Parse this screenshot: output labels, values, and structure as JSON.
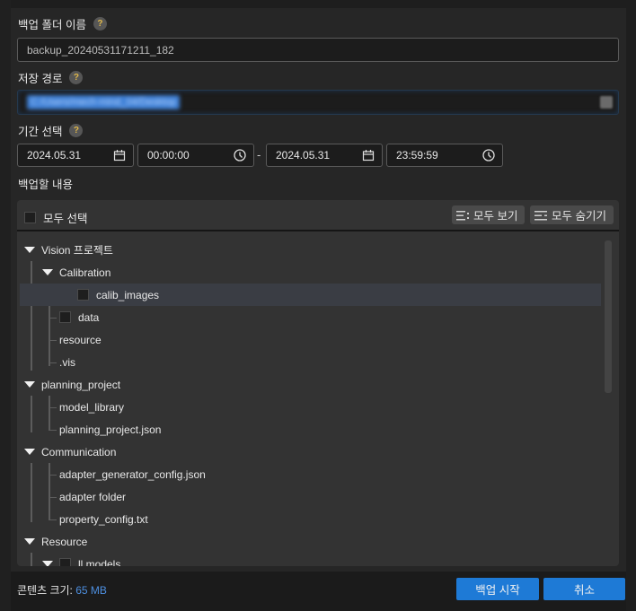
{
  "backup_name": {
    "label": "백업 폴더 이름",
    "help": "?",
    "value": "backup_20240531171211_182"
  },
  "save_path": {
    "label": "저장 경로",
    "help": "?",
    "value": "C:/Users/mech-mind_04/Desktop",
    "folder_icon": "folder-icon"
  },
  "period": {
    "label": "기간 선택",
    "help": "?",
    "start_date": "2024.05.31",
    "start_time": "00:00:00",
    "separator": "-",
    "end_date": "2024.05.31",
    "end_time": "23:59:59"
  },
  "content": {
    "label": "백업할 내용",
    "select_all": "모두 선택",
    "expand_all": "모두 보기",
    "collapse_all": "모두 숨기기"
  },
  "tree": [
    {
      "label": "Vision 프로젝트",
      "level": 0,
      "expanded": true,
      "checkbox": false
    },
    {
      "label": "Calibration",
      "level": 1,
      "expanded": true,
      "checkbox": false
    },
    {
      "label": "calib_images",
      "level": 2,
      "checkbox": true,
      "selected": true
    },
    {
      "label": "data",
      "level": 1,
      "checkbox": true
    },
    {
      "label": "resource",
      "level": 1,
      "checkbox": false
    },
    {
      "label": ".vis",
      "level": 1,
      "checkbox": false
    },
    {
      "label": "planning_project",
      "level": 0,
      "expanded": true,
      "checkbox": false
    },
    {
      "label": "model_library",
      "level": 1,
      "checkbox": false
    },
    {
      "label": "planning_project.json",
      "level": 1,
      "checkbox": false
    },
    {
      "label": "Communication",
      "level": 0,
      "expanded": true,
      "checkbox": false
    },
    {
      "label": "adapter_generator_config.json",
      "level": 1,
      "checkbox": false
    },
    {
      "label": "adapter folder",
      "level": 1,
      "checkbox": false
    },
    {
      "label": "property_config.txt",
      "level": 1,
      "checkbox": false
    },
    {
      "label": "Resource",
      "level": 0,
      "expanded": true,
      "checkbox": false
    },
    {
      "label": "ll models",
      "level": 1,
      "expanded": true,
      "checkbox": true
    }
  ],
  "footer": {
    "size_label": "콘텐츠 크기:",
    "size_value": "65 MB",
    "start_button": "백업 시작",
    "cancel_button": "취소"
  },
  "colors": {
    "accent": "#1e7ad6",
    "size_value": "#4d8fe0",
    "help_icon": "#e0b84a"
  }
}
